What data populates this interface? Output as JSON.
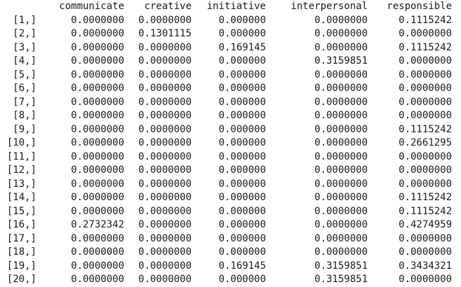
{
  "console": {
    "columns": [
      "communicate",
      "creative",
      "initiative",
      "interpersonal",
      "responsible"
    ],
    "rows": [
      {
        "label": "[1,]",
        "values": [
          "0.0000000",
          "0.0000000",
          "0.000000",
          "0.0000000",
          "0.1115242"
        ]
      },
      {
        "label": "[2,]",
        "values": [
          "0.0000000",
          "0.1301115",
          "0.000000",
          "0.0000000",
          "0.0000000"
        ]
      },
      {
        "label": "[3,]",
        "values": [
          "0.0000000",
          "0.0000000",
          "0.169145",
          "0.0000000",
          "0.1115242"
        ]
      },
      {
        "label": "[4,]",
        "values": [
          "0.0000000",
          "0.0000000",
          "0.000000",
          "0.3159851",
          "0.0000000"
        ]
      },
      {
        "label": "[5,]",
        "values": [
          "0.0000000",
          "0.0000000",
          "0.000000",
          "0.0000000",
          "0.0000000"
        ]
      },
      {
        "label": "[6,]",
        "values": [
          "0.0000000",
          "0.0000000",
          "0.000000",
          "0.0000000",
          "0.0000000"
        ]
      },
      {
        "label": "[7,]",
        "values": [
          "0.0000000",
          "0.0000000",
          "0.000000",
          "0.0000000",
          "0.0000000"
        ]
      },
      {
        "label": "[8,]",
        "values": [
          "0.0000000",
          "0.0000000",
          "0.000000",
          "0.0000000",
          "0.0000000"
        ]
      },
      {
        "label": "[9,]",
        "values": [
          "0.0000000",
          "0.0000000",
          "0.000000",
          "0.0000000",
          "0.1115242"
        ]
      },
      {
        "label": "[10,]",
        "values": [
          "0.0000000",
          "0.0000000",
          "0.000000",
          "0.0000000",
          "0.2661295"
        ]
      },
      {
        "label": "[11,]",
        "values": [
          "0.0000000",
          "0.0000000",
          "0.000000",
          "0.0000000",
          "0.0000000"
        ]
      },
      {
        "label": "[12,]",
        "values": [
          "0.0000000",
          "0.0000000",
          "0.000000",
          "0.0000000",
          "0.0000000"
        ]
      },
      {
        "label": "[13,]",
        "values": [
          "0.0000000",
          "0.0000000",
          "0.000000",
          "0.0000000",
          "0.0000000"
        ]
      },
      {
        "label": "[14,]",
        "values": [
          "0.0000000",
          "0.0000000",
          "0.000000",
          "0.0000000",
          "0.1115242"
        ]
      },
      {
        "label": "[15,]",
        "values": [
          "0.0000000",
          "0.0000000",
          "0.000000",
          "0.0000000",
          "0.1115242"
        ]
      },
      {
        "label": "[16,]",
        "values": [
          "0.2732342",
          "0.0000000",
          "0.000000",
          "0.0000000",
          "0.4274959"
        ]
      },
      {
        "label": "[17,]",
        "values": [
          "0.0000000",
          "0.0000000",
          "0.000000",
          "0.0000000",
          "0.0000000"
        ]
      },
      {
        "label": "[18,]",
        "values": [
          "0.0000000",
          "0.0000000",
          "0.000000",
          "0.0000000",
          "0.0000000"
        ]
      },
      {
        "label": "[19,]",
        "values": [
          "0.0000000",
          "0.0000000",
          "0.169145",
          "0.3159851",
          "0.3434321"
        ]
      },
      {
        "label": "[20,]",
        "values": [
          "0.0000000",
          "0.0000000",
          "0.000000",
          "0.3159851",
          "0.0000000"
        ]
      }
    ]
  }
}
